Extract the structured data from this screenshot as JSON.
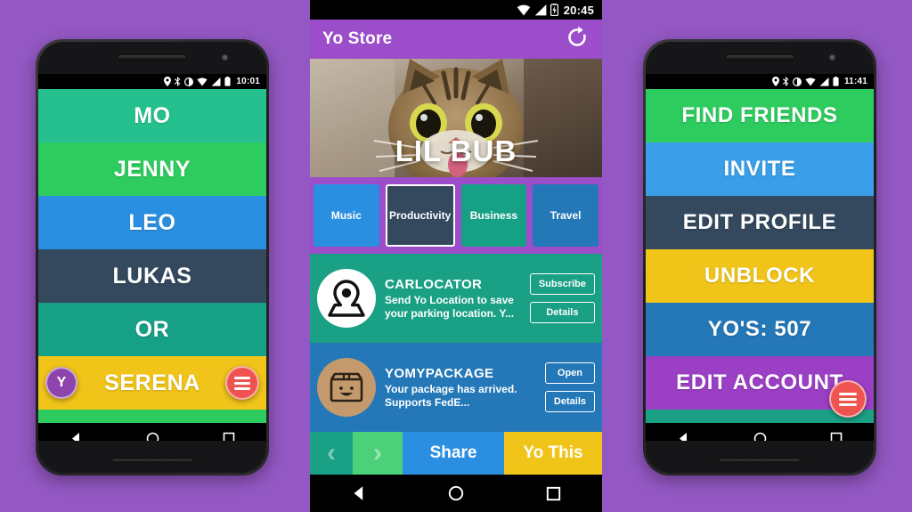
{
  "background_color": "#9458c4",
  "left_phone": {
    "device_name": "android-phone-left",
    "statusbar": {
      "time": "10:01",
      "icons": [
        "location-pin-icon",
        "bluetooth-icon",
        "do-not-disturb-icon",
        "wifi-icon",
        "cell-signal-icon",
        "battery-icon"
      ]
    },
    "rows": [
      {
        "label": "MO",
        "color": "#26c08f"
      },
      {
        "label": "JENNY",
        "color": "#2ecc5f"
      },
      {
        "label": "LEO",
        "color": "#2a8fe0"
      },
      {
        "label": "LUKAS",
        "color": "#34495e"
      },
      {
        "label": "OR",
        "color": "#16a085"
      },
      {
        "label": "SERENA",
        "color": "#f0c419"
      }
    ],
    "tail_strip_color": "#2ecc5f",
    "y_badge": {
      "label": "Y",
      "color": "#8e44ad"
    },
    "fab": {
      "icon": "hamburger-menu-icon",
      "color": "#ef5350"
    },
    "navbar": [
      "back-triangle-icon",
      "home-circle-icon",
      "recents-square-icon"
    ]
  },
  "center_phone": {
    "device_name": "android-phone-center",
    "statusbar": {
      "time": "20:45",
      "icons": [
        "wifi-icon",
        "cell-signal-icon",
        "battery-charging-icon"
      ]
    },
    "appbar": {
      "title": "Yo Store",
      "refresh_icon": "refresh-icon",
      "color": "#9b4dca"
    },
    "hero": {
      "title": "LIL BUB",
      "image_alt": "cat-photo-lil-bub"
    },
    "tabs": [
      {
        "label": "Music",
        "color": "#2a8fe0",
        "selected": false
      },
      {
        "label": "Productivity",
        "color": "#34495e",
        "selected": true
      },
      {
        "label": "Business",
        "color": "#16a085",
        "selected": false
      },
      {
        "label": "Travel",
        "color": "#2478b8",
        "selected": false
      }
    ],
    "store_items": [
      {
        "name": "CARLOCATOR",
        "description": "Send Yo Location to save your parking location. Y...",
        "background": "#1aa085",
        "avatar_color": "#ffffff",
        "avatar_icon": "location-pin-icon",
        "primary_button": "Subscribe",
        "secondary_button": "Details"
      },
      {
        "name": "YOMYPACKAGE",
        "description": "Your package has arrived. Supports FedE...",
        "background": "#2478b8",
        "avatar_color": "#c49a6c",
        "avatar_icon": "package-box-icon",
        "primary_button": "Open",
        "secondary_button": "Details"
      }
    ],
    "actionbar": {
      "prev_icon": "chevron-left-icon",
      "prev_color": "#1aa085",
      "next_icon": "chevron-right-icon",
      "next_color": "#4cd07a",
      "share_label": "Share",
      "share_color": "#2a8fe0",
      "yothis_label": "Yo This",
      "yothis_color": "#f0c419"
    },
    "navbar": [
      "back-triangle-icon",
      "home-circle-icon",
      "recents-square-icon"
    ]
  },
  "right_phone": {
    "device_name": "android-phone-right",
    "statusbar": {
      "time": "11:41",
      "icons": [
        "location-pin-icon",
        "bluetooth-icon",
        "do-not-disturb-icon",
        "wifi-icon",
        "cell-signal-icon",
        "battery-icon"
      ]
    },
    "rows": [
      {
        "label": "FIND FRIENDS",
        "color": "#2ecc5f"
      },
      {
        "label": "INVITE",
        "color": "#3a9fe8"
      },
      {
        "label": "EDIT PROFILE",
        "color": "#34495e"
      },
      {
        "label": "UNBLOCK",
        "color": "#f0c419"
      },
      {
        "label": "YO'S: 507",
        "color": "#2478b8"
      },
      {
        "label": "EDIT ACCOUNT",
        "color": "#9b3fc4"
      }
    ],
    "tail_strip_color": "#1aa085",
    "fab": {
      "icon": "hamburger-menu-icon",
      "color": "#ef5350"
    },
    "navbar": [
      "back-triangle-icon",
      "home-circle-icon",
      "recents-square-icon"
    ]
  }
}
